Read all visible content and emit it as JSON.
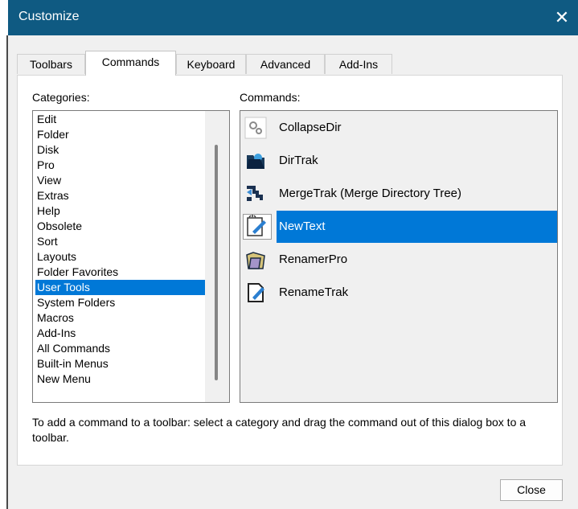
{
  "window": {
    "title": "Customize",
    "close_glyph": "✕"
  },
  "tabs": [
    {
      "label": "Toolbars",
      "active": false
    },
    {
      "label": "Commands",
      "active": true
    },
    {
      "label": "Keyboard",
      "active": false
    },
    {
      "label": "Advanced",
      "active": false
    },
    {
      "label": "Add-Ins",
      "active": false
    }
  ],
  "categories": {
    "label": "Categories:",
    "items": [
      "Edit",
      "Folder",
      "Disk",
      "Pro",
      "View",
      "Extras",
      "Help",
      "Obsolete",
      "Sort",
      "Layouts",
      "Folder Favorites",
      "User Tools",
      "System Folders",
      "Macros",
      "Add-Ins",
      "All Commands",
      "Built-in Menus",
      "New Menu"
    ],
    "selected": "User Tools"
  },
  "commands": {
    "label": "Commands:",
    "items": [
      {
        "label": "CollapseDir",
        "icon": "gears-icon"
      },
      {
        "label": "DirTrak",
        "icon": "folder-tracker-icon"
      },
      {
        "label": "MergeTrak (Merge Directory Tree)",
        "icon": "merge-arrows-icon"
      },
      {
        "label": "NewText",
        "icon": "new-text-icon"
      },
      {
        "label": "RenamerPro",
        "icon": "renamer-folder-icon"
      },
      {
        "label": "RenameTrak",
        "icon": "rename-document-icon"
      }
    ],
    "selected": "NewText"
  },
  "hint": "To add a command to a toolbar: select a category and drag the command out of this dialog box to a toolbar.",
  "buttons": {
    "close": "Close"
  },
  "colors": {
    "titlebar": "#0f5a82",
    "selection": "#0078d7"
  }
}
